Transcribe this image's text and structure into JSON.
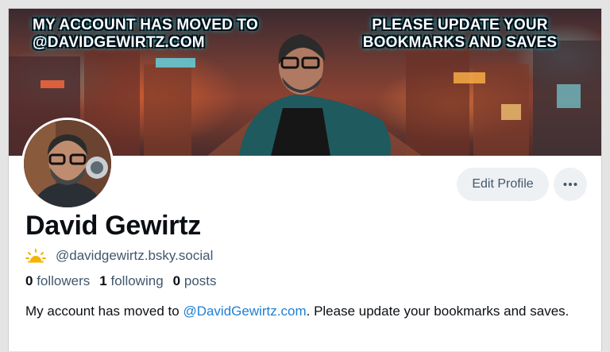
{
  "banner": {
    "left_text": "MY ACCOUNT HAS MOVED TO @DAVIDGEWIRTZ.COM",
    "right_text": "PLEASE UPDATE YOUR BOOKMARKS AND SAVES"
  },
  "profile": {
    "display_name": "David Gewirtz",
    "handle": "@davidgewirtz.bsky.social",
    "handle_icon": "sun-cloud-icon",
    "stats": {
      "followers_count": "0",
      "followers_label": "followers",
      "following_count": "1",
      "following_label": "following",
      "posts_count": "0",
      "posts_label": "posts"
    },
    "bio": {
      "before": "My account has moved to ",
      "link": "@DavidGewirtz.com",
      "after": ". Please update your bookmarks and saves."
    }
  },
  "actions": {
    "edit_profile_label": "Edit Profile",
    "more_icon": "ellipsis-icon"
  },
  "colors": {
    "link": "#1f7fd1",
    "muted_text": "#42576c",
    "button_bg": "#eef1f4",
    "sun_icon": "#f5b301"
  }
}
